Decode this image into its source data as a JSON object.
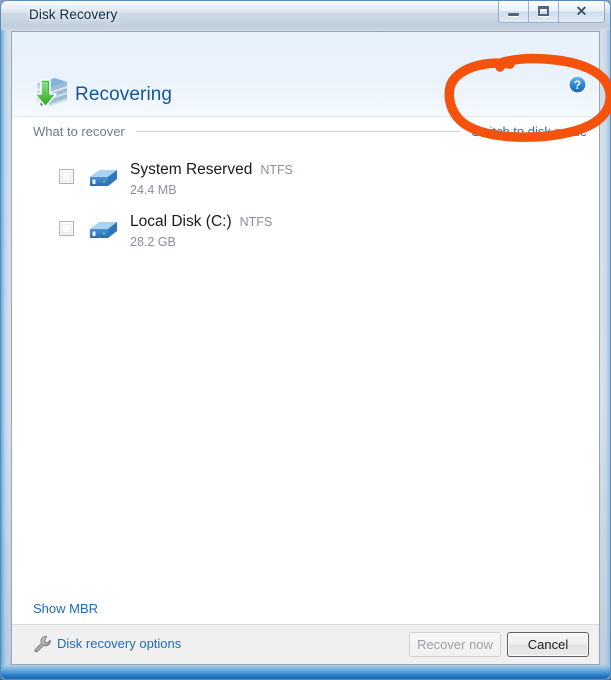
{
  "window": {
    "title": "Disk Recovery",
    "controls": {
      "minimize": "minimize-button",
      "maximize": "maximize-button",
      "close": "✕"
    }
  },
  "header": {
    "title": "Recovering",
    "icon": "disk-recovery-icon",
    "help_icon": "?"
  },
  "section": {
    "label": "What to recover",
    "link": "Switch to disk mode"
  },
  "volumes": [
    {
      "name": "System Reserved",
      "filesystem": "NTFS",
      "size": "24.4 MB",
      "checked": false
    },
    {
      "name": "Local Disk (C:)",
      "filesystem": "NTFS",
      "size": "28.2 GB",
      "checked": false
    }
  ],
  "links": {
    "show_mbr": "Show MBR",
    "disk_recovery_options": "Disk recovery options"
  },
  "buttons": {
    "recover_now": "Recover now",
    "cancel": "Cancel"
  },
  "annotation": {
    "shape": "hand-drawn-ellipse",
    "color": "#f4520d",
    "targets": "Switch to disk mode"
  },
  "colors": {
    "link": "#1c6bbf",
    "header_title": "#14569e",
    "annotation": "#f4520d"
  }
}
